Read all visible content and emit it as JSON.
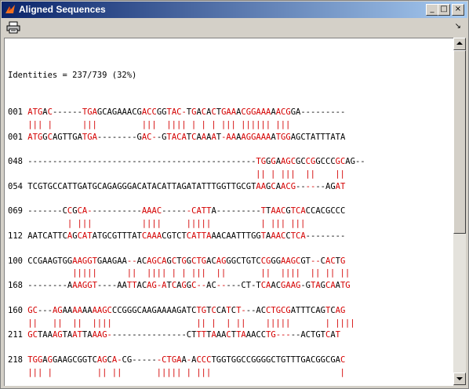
{
  "window": {
    "title": "Aligned Sequences",
    "controls": {
      "minimize": "_",
      "maximize": "□",
      "close": "×"
    }
  },
  "toolbar": {
    "print_icon": "printer-icon",
    "arrow_icon": "↘"
  },
  "alignment": {
    "identities": "Identities = 237/739 (32%)",
    "blocks": [
      {
        "top_num": "001",
        "top_seq": "ATGAC------TGAGCAGAAACGACCGGTAC-TGACACTGAAACGGAAAAACGGA---------",
        "match": "||| |      |||         |||  |||| | | | ||| |||||| |||           ",
        "bot_num": "001",
        "bot_seq": "ATGGCAGTTGATGA--------GAC--GTACATCAAAAT-AAAAGGAAAATGGAGCTATTTATA"
      },
      {
        "top_num": "048",
        "top_seq": "----------------------------------------------TGGGAAGCGCCGGCCCGCAG--",
        "match": "                                              || | |||  ||    ||",
        "bot_num": "054",
        "bot_seq": "TCGTGCCATTGATGCAGAGGGACATACATTAGATATTTGGTTGCGTAAGCAACG------AGAT"
      },
      {
        "top_num": "069",
        "top_seq": "-------CCGCA-----------AAAC------CATTA---------TTAACGTCACCACGCCC",
        "match": "        | |||          ||||     |||||          | ||| |||",
        "bot_num": "112",
        "bot_seq": "AATCATTCAGCATATGCGTTTATCAAACGTCTCATTAAACAATTTGGTAAACCTCA--------"
      },
      {
        "top_num": "100",
        "top_seq": "CCGAAGTGGAAGGTGAAGAA--ACAGCAGCTGGCTGACAGGGCTGTCCGGGAAGCGT--CACTG",
        "match": "         |||||      ||  |||| | | |||  ||       ||  ||||  || || ||",
        "bot_num": "168",
        "bot_seq": "--------AAAGGT----AATTACAG-ATCAGGC--AC-----CT-TCAACGAAG-GTAGCAATG"
      },
      {
        "top_num": "160",
        "top_seq": "GC---AGAAAAAAAAGCCCGGGCAAGAAAAGATCTGTCCATCT---ACCTGCGATTTCAGTCAG",
        "match": "||   ||  ||  ||||                 || |  | ||    |||||       | ||||",
        "bot_num": "211",
        "bot_seq": "GCTAAAGTAATTAAAG----------------CTTTTAAACTTAAACCTG-----ACTGTCAT"
      },
      {
        "top_num": "218",
        "top_seq": "TGGAGGAAGCGGTCAGCA-CG------CTGAA-ACCCTGGTGGCCGGGGCTGTTTGACGGCGAC",
        "match": "||| |         || ||       ||||| | |||                          |",
        "bot_num": "",
        "bot_seq": ""
      }
    ]
  }
}
